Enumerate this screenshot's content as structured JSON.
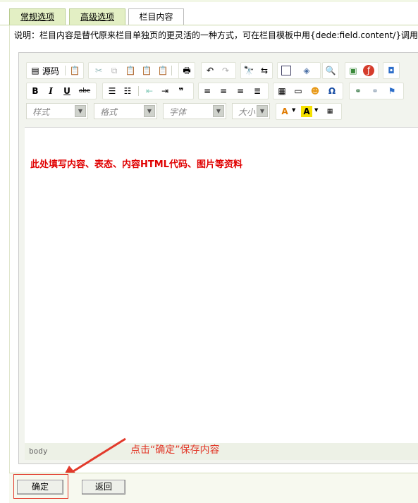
{
  "tabs": [
    {
      "label": "常规选项",
      "active": false
    },
    {
      "label": "高级选项",
      "active": false
    },
    {
      "label": "栏目内容",
      "active": true
    }
  ],
  "description": "说明：栏目内容是替代原来栏目单独页的更灵活的一种方式，可在栏目模板中用{dede:field.content/}调用",
  "toolbar": {
    "source_label": "源码",
    "bold": "B",
    "italic": "I",
    "underline": "U",
    "strike": "abc",
    "style_combo": "样式",
    "format_combo": "格式",
    "font_combo": "字体",
    "size_combo": "大小",
    "text_color": "A",
    "bg_color": "A"
  },
  "editor": {
    "content_text": "此处填写内容、表态、内容HTML代码、图片等资料",
    "status_path": "body"
  },
  "annotation": "点击“确定”保存内容",
  "buttons": {
    "confirm": "确定",
    "back": "返回"
  },
  "colors": {
    "content_text": "#e00000",
    "annotation": "#e23a2b",
    "tab_bg": "#e3efc4"
  }
}
